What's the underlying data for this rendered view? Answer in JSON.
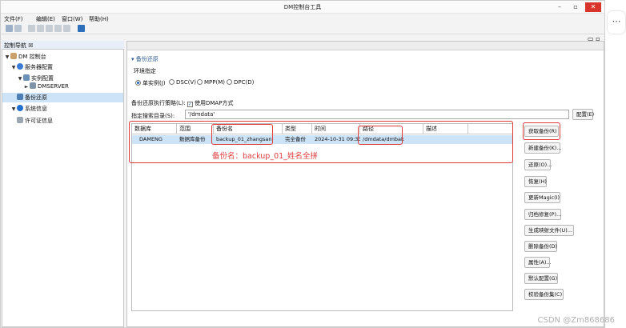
{
  "window": {
    "title": "DM控制台工具"
  },
  "menubar": [
    "文件(F)",
    "编辑(E)",
    "窗口(W)",
    "帮助(H)"
  ],
  "nav_panel": {
    "title": "控制导航 ☒",
    "tree": [
      {
        "label": "DM 控制台"
      },
      {
        "label": "服务器配置"
      },
      {
        "label": "实例配置"
      },
      {
        "label": "DMSERVER"
      },
      {
        "label": "备份还原"
      },
      {
        "label": "系统信息"
      },
      {
        "label": "许可证信息"
      }
    ]
  },
  "main": {
    "section_title": "▾ 备份还原",
    "env_label": "环境指定",
    "radios": [
      {
        "label": "单实例(J)",
        "selected": true
      },
      {
        "label": "DSC(V)",
        "selected": false
      },
      {
        "label": "MPP(M)",
        "selected": false
      },
      {
        "label": "DPC(D)",
        "selected": false
      }
    ],
    "strategy_label": "备份还原执行策略(L):",
    "dmap_checkbox": "使用DMAP方式",
    "search_dir_label": "指定搜索目录(S):",
    "search_dir_value": "'/dmdata'",
    "config_button": "配置(E)",
    "table": {
      "columns": [
        "数据库",
        "范围",
        "备份名",
        "类型",
        "时间",
        "路径",
        "描述"
      ],
      "rows": [
        [
          "DAMENG",
          "数据库备份",
          "backup_01_zhangsan",
          "完全备份",
          "2024-10-31 09:33...",
          "/dmdata/dmbak",
          ""
        ]
      ]
    },
    "annotation": "备份名：backup_01_姓名全拼",
    "buttons": [
      "获取备份(R)",
      "新建备份(K)...",
      "还原(O)...",
      "恢复(H)",
      "更新Magic(I)",
      "归档修复(P)...",
      "生成映射文件(U)...",
      "删除备份(D)",
      "属性(A)...",
      "默认配置(G)",
      "校验备份集(C)"
    ]
  },
  "watermark": "CSDN @Zm868686"
}
